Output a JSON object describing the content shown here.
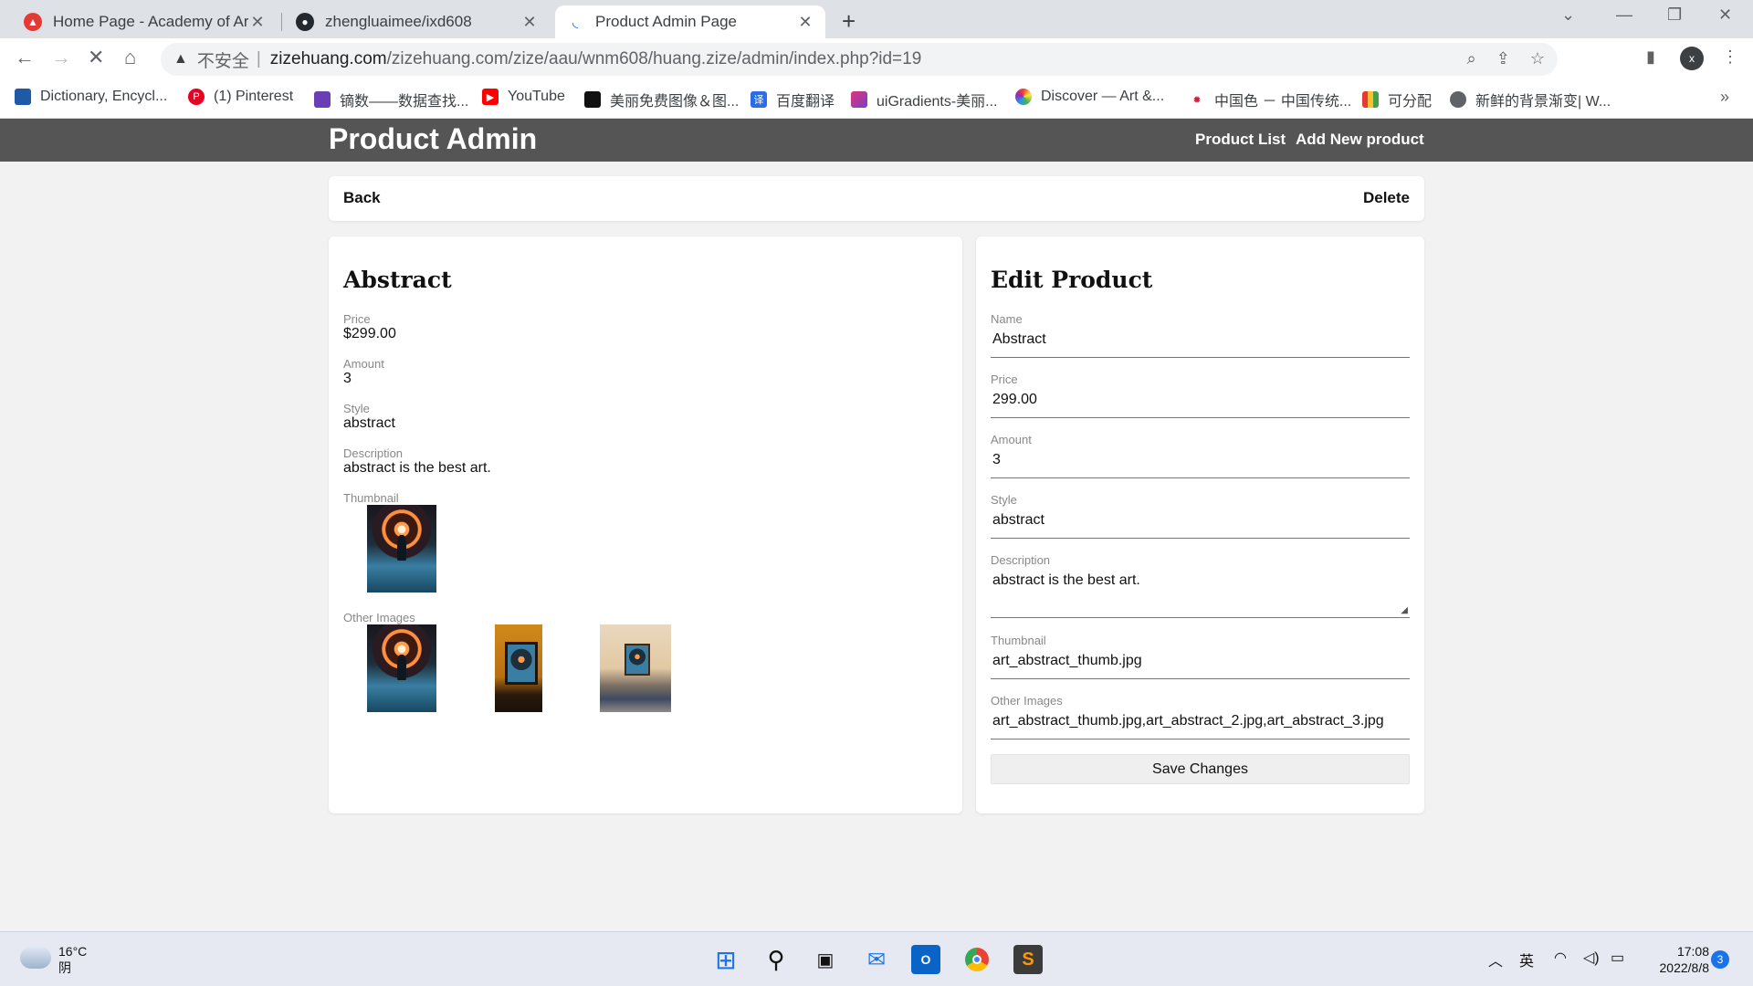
{
  "browser": {
    "tabs": [
      {
        "title": "Home Page - Academy of Art",
        "favicon_color": "#e53935"
      },
      {
        "title": "zhengluaimee/ixd608",
        "favicon_color": "#24292f"
      },
      {
        "title": "Product Admin Page",
        "favicon_color": "#1a73e8"
      }
    ],
    "new_tab": "+",
    "address": {
      "security_label": "不安全",
      "host": "zizehuang.com",
      "path": "/zizehuang.com/zize/aau/wnm608/huang.zize/admin/index.php?id=19"
    },
    "profile_initial": "x",
    "bookmarks": [
      "Dictionary, Encycl...",
      "(1) Pinterest",
      "镝数——数据查找...",
      "YouTube",
      "美丽免费图像＆图...",
      "百度翻译",
      "uiGradients-美丽...",
      "Discover — Art &...",
      "中国色 － 中国传统...",
      "可分配",
      "新鲜的背景渐变| W..."
    ],
    "bookmarks_more": "»"
  },
  "header": {
    "brand": "Product Admin",
    "nav": [
      "Product List",
      "Add New product"
    ]
  },
  "actions": {
    "back": "Back",
    "delete": "Delete"
  },
  "product": {
    "name": "Abstract",
    "price_label": "Price",
    "price": "$299.00",
    "amount_label": "Amount",
    "amount": "3",
    "style_label": "Style",
    "style": "abstract",
    "description_label": "Description",
    "description": "abstract is the best art.",
    "thumbnail_label": "Thumbnail",
    "other_images_label": "Other Images"
  },
  "edit_form": {
    "title": "Edit Product",
    "fields": [
      {
        "label": "Name",
        "value": "Abstract"
      },
      {
        "label": "Price",
        "value": "299.00"
      },
      {
        "label": "Amount",
        "value": "3"
      },
      {
        "label": "Style",
        "value": "abstract"
      },
      {
        "label": "Description",
        "value": "abstract is the best art."
      },
      {
        "label": "Thumbnail",
        "value": "art_abstract_thumb.jpg"
      },
      {
        "label": "Other Images",
        "value": "art_abstract_thumb.jpg,art_abstract_2.jpg,art_abstract_3.jpg"
      }
    ],
    "submit": "Save Changes"
  },
  "taskbar": {
    "weather_temp": "16°C",
    "weather_desc": "阴",
    "ime": "英",
    "time": "17:08",
    "date": "2022/8/8",
    "notifications": "3"
  }
}
